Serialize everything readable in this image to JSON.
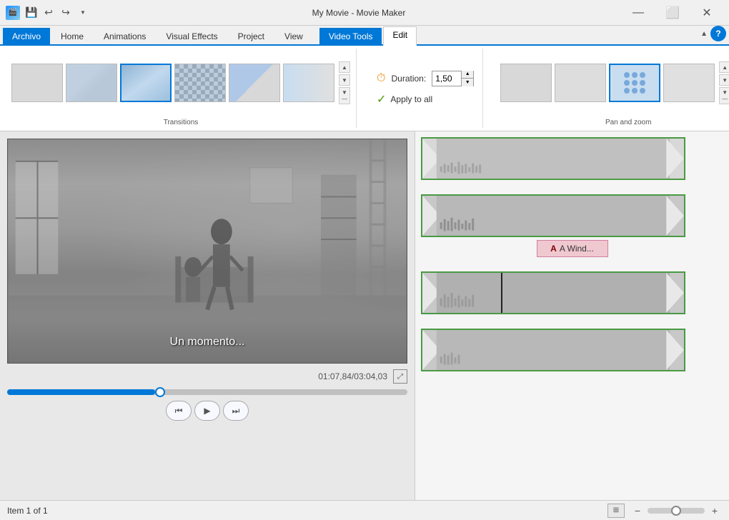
{
  "titleBar": {
    "appIcon": "🎬",
    "title": "My Movie - Movie Maker",
    "quickAccess": [
      "💾",
      "↩",
      "↪"
    ],
    "windowControls": [
      "—",
      "⬜",
      "✕"
    ]
  },
  "ribbonTabs": {
    "tabs": [
      "Archivo",
      "Home",
      "Animations",
      "Visual Effects",
      "Project",
      "View",
      "Edit"
    ],
    "activeTab": "Edit",
    "videoToolsLabel": "Video Tools"
  },
  "transitions": {
    "sectionLabel": "Transitions",
    "items": [
      {
        "id": "blank",
        "label": ""
      },
      {
        "id": "fade",
        "label": ""
      },
      {
        "id": "selected",
        "label": ""
      },
      {
        "id": "checkerboard",
        "label": ""
      },
      {
        "id": "diagonal",
        "label": ""
      },
      {
        "id": "slide",
        "label": ""
      }
    ],
    "duration": {
      "label": "Duration:",
      "value": "1,50",
      "icon": "⏱"
    },
    "applyAll": {
      "label": "Apply to all",
      "icon": "✓"
    }
  },
  "panAndZoom": {
    "sectionLabel": "Pan and zoom",
    "items": [
      {
        "id": "blank1"
      },
      {
        "id": "blank2"
      },
      {
        "id": "active"
      },
      {
        "id": "blank3"
      }
    ]
  },
  "preview": {
    "subtitle": "Un momento...",
    "timestamp": "01:07,84/03:04,03",
    "seekPercent": 37,
    "controls": [
      "⏮",
      "▶",
      "⏭"
    ]
  },
  "timeline": {
    "clips": [
      {
        "id": "clip1",
        "selected": true,
        "hasPlayhead": false
      },
      {
        "id": "clip2",
        "selected": false,
        "hasCaption": true,
        "captionLabel": "A Wind..."
      },
      {
        "id": "clip3",
        "selected": false,
        "hasPlayhead": true
      },
      {
        "id": "clip4",
        "selected": false
      }
    ]
  },
  "statusBar": {
    "text": "Item 1 of 1"
  }
}
